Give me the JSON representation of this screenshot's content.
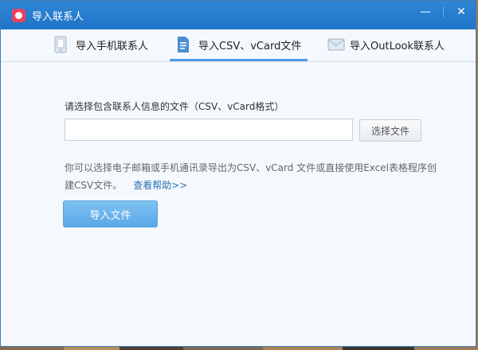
{
  "window": {
    "title": "导入联系人",
    "minimize_icon": "minimize-icon",
    "close_icon": "close-icon",
    "close_glyph": "✕",
    "minimize_glyph": "—"
  },
  "tabs": [
    {
      "label": "导入手机联系人",
      "icon": "phone-icon",
      "active": false
    },
    {
      "label": "导入CSV、vCard文件",
      "icon": "document-icon",
      "active": true
    },
    {
      "label": "导入OutLook联系人",
      "icon": "mail-icon",
      "active": false
    }
  ],
  "form": {
    "prompt": "请选择包含联系人信息的文件（CSV、vCard格式）",
    "file_value": "",
    "choose_label": "选择文件",
    "hint": "你可以选择电子邮箱或手机通讯录导出为CSV、vCard 文件或直接使用Excel表格程序创建CSV文件。",
    "help_link": "查看帮助>>",
    "import_label": "导入文件"
  },
  "colors": {
    "titlebar": "#2a80d2",
    "accent": "#4d9be4",
    "import_button": "#6cb4ee"
  }
}
